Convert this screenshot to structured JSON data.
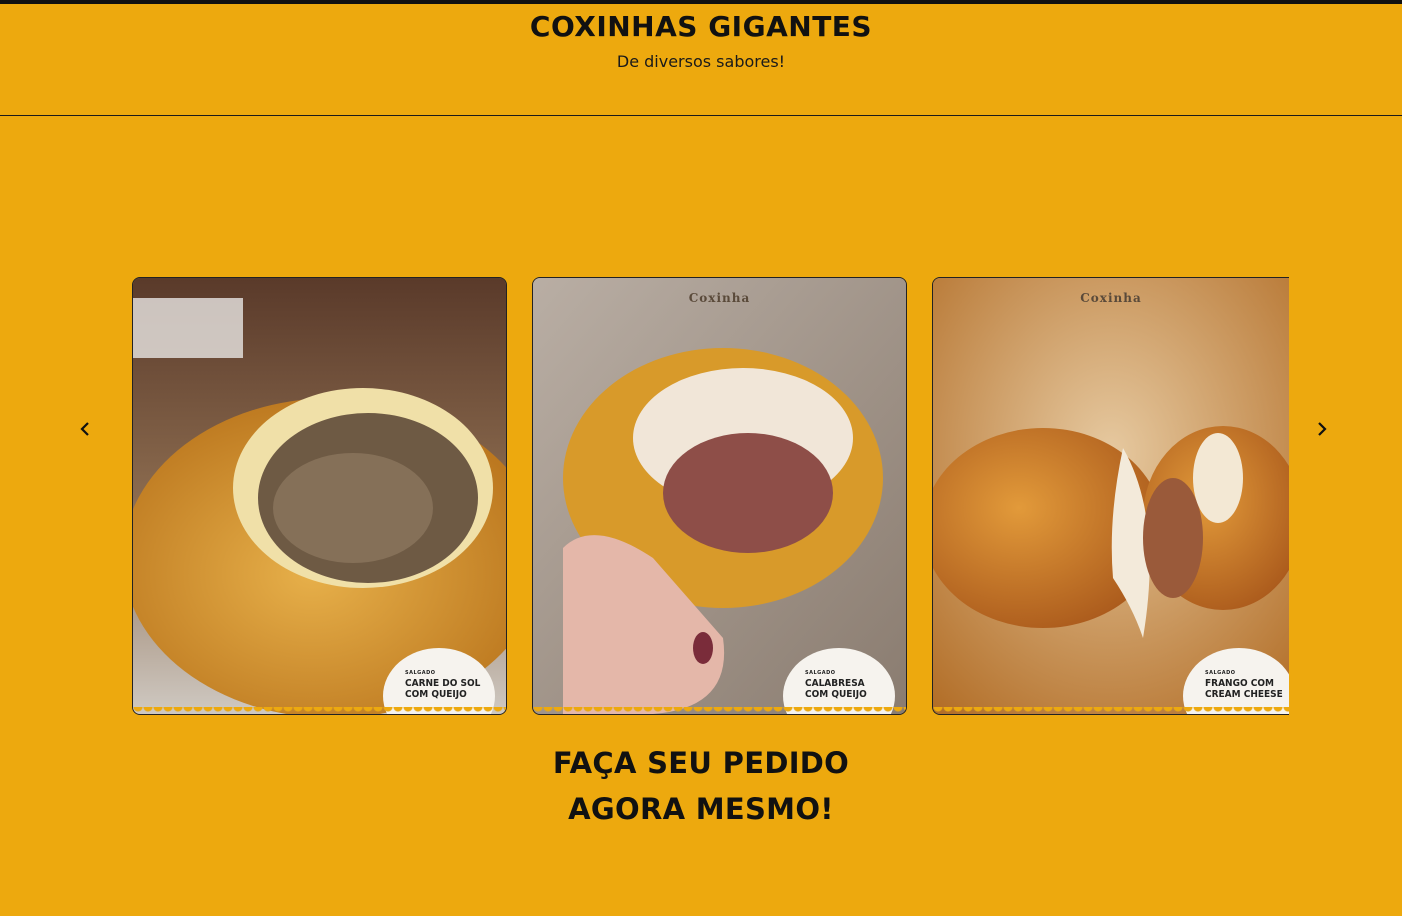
{
  "header": {
    "title": "COXINHAS GIGANTES",
    "subtitle": "De diversos sabores!"
  },
  "carousel": {
    "prev_icon": "chevron-left-icon",
    "next_icon": "chevron-right-icon",
    "slides": [
      {
        "badge_small": "SALGADO",
        "badge_label": "CARNE DO SOL COM QUEIJO",
        "brand": ""
      },
      {
        "badge_small": "SALGADO",
        "badge_label": "CALABRESA COM QUEIJO",
        "brand": "Coxinha"
      },
      {
        "badge_small": "SALGADO",
        "badge_label": "FRANGO COM CREAM CHEESE",
        "brand": "Coxinha"
      }
    ]
  },
  "cta": {
    "line1": "FAÇA SEU PEDIDO",
    "line2": "AGORA MESMO!"
  },
  "colors": {
    "background": "#eda90e",
    "text": "#111111"
  }
}
